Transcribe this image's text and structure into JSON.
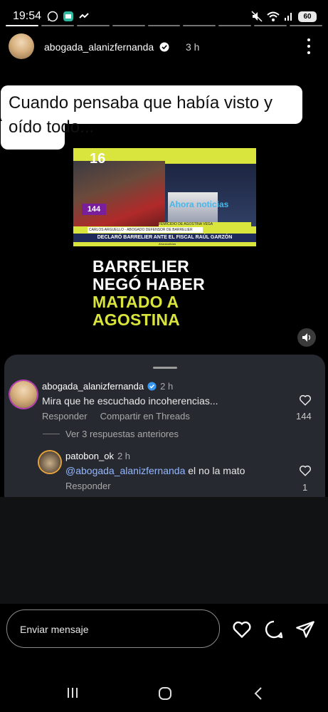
{
  "status_bar": {
    "time": "19:54",
    "battery": "60"
  },
  "story": {
    "username": "abogada_alanizfernanda",
    "time": "3 h",
    "segments_total": 9,
    "segments_done": 1
  },
  "caption": {
    "text": "Cuando pensaba que había visto y oído todo..."
  },
  "thumbnail": {
    "channel_number": "16",
    "logo": "Ahora noticias",
    "badge": "144",
    "lower_third_top": "CARLOS ARGUELLO - ABOGADO DEFENSOR DE BARRELIER",
    "lower_third_main": "DECLARÓ BARRELIER ANTE EL FISCAL RAÚL GARZÓN",
    "lower_third_sub": "FEMICIDIO DE AGOSTINA VEGA",
    "footer": "Ahoranoticias"
  },
  "headline": {
    "line1": "BARRELIER",
    "line2": "NEGÓ HABER",
    "line3": "MATADO A",
    "line4": "AGOSTINA"
  },
  "comments": {
    "c1": {
      "username": "abogada_alanizfernanda",
      "time": "2 h",
      "text": "Mira que he escuchado incoherencias...",
      "reply_label": "Responder",
      "share_label": "Compartir en Threads",
      "likes": "144"
    },
    "view_replies": "Ver 3 respuestas anteriores",
    "c2": {
      "username": "patobon_ok",
      "time": "2 h",
      "mention": "@abogada_alanizfernanda",
      "text": " el no la mato",
      "reply_label": "Responder",
      "likes": "1"
    }
  },
  "message_bar": {
    "placeholder": "Enviar mensaje"
  },
  "colors": {
    "accent_yellow": "#d9e43c",
    "mention_blue": "#93b6ff",
    "sheet_bg": "#262a30"
  },
  "icons": [
    "whatsapp-icon",
    "gallery-icon",
    "mute-icon",
    "wifi-icon",
    "signal-icon",
    "more-options-icon",
    "verified-icon",
    "speaker-icon",
    "heart-icon",
    "comment-icon",
    "send-icon",
    "recent-apps-icon",
    "home-icon",
    "back-icon"
  ]
}
